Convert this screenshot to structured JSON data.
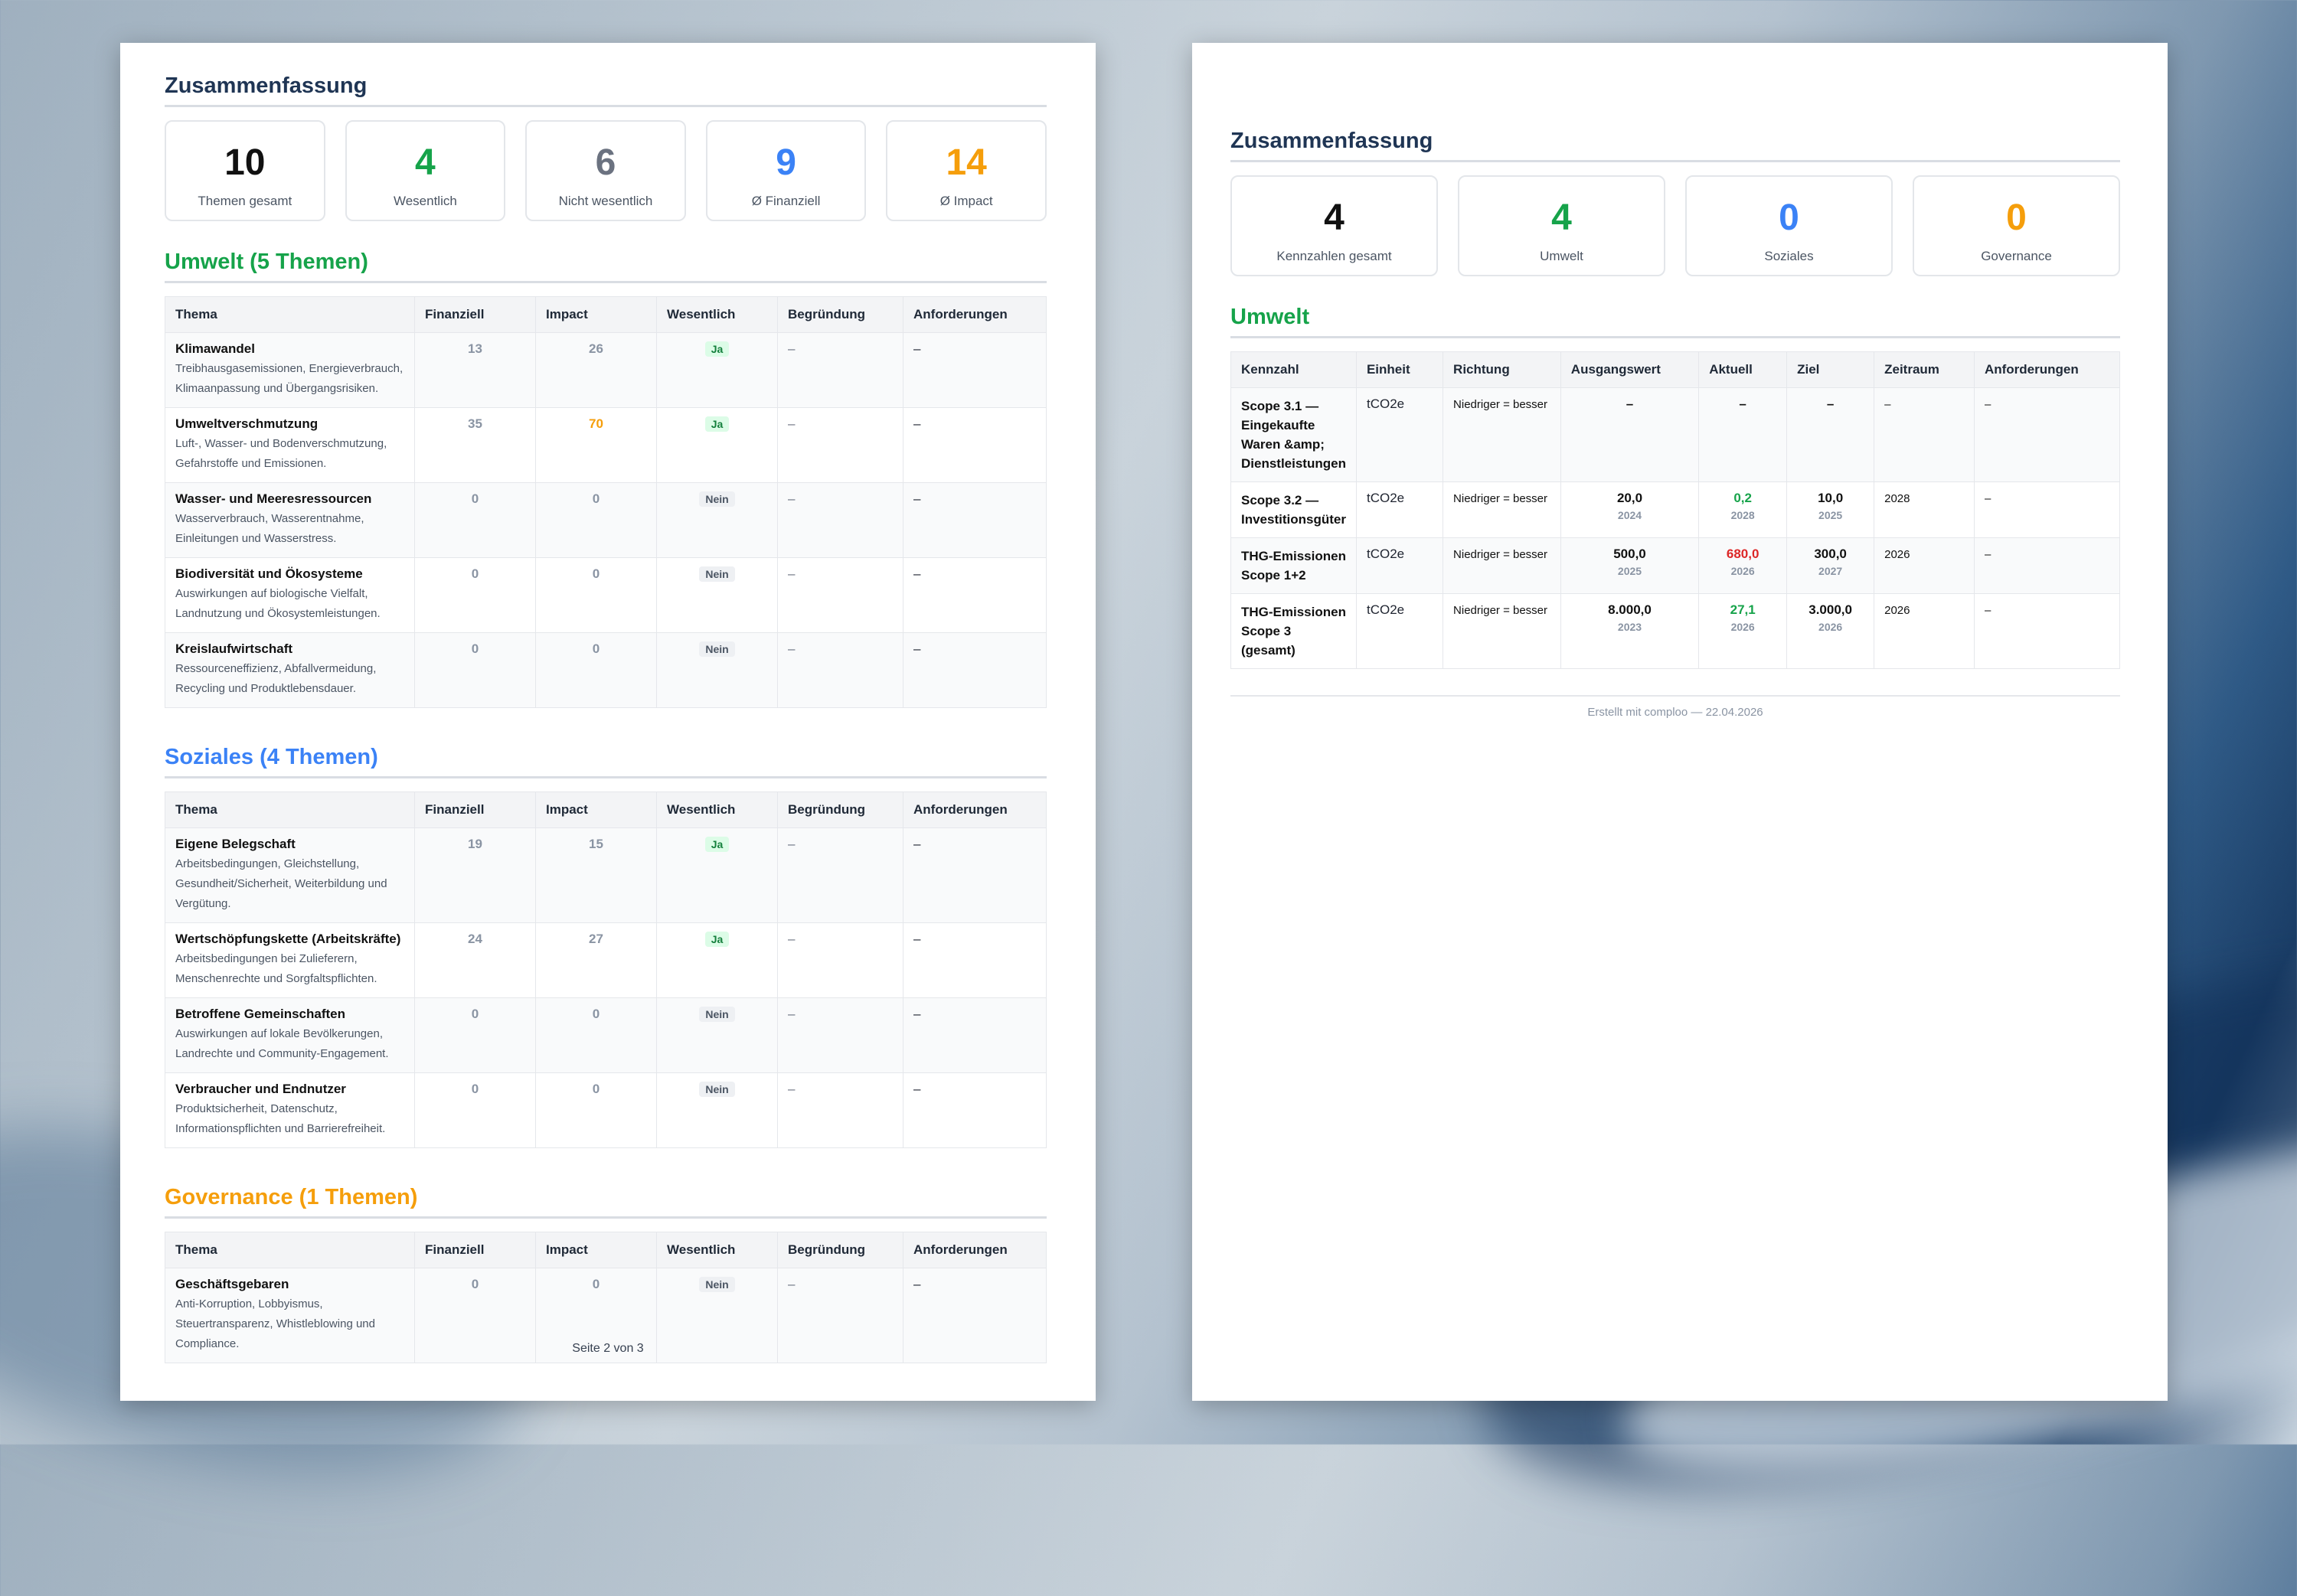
{
  "page1": {
    "summary_title": "Zusammenfassung",
    "cards": [
      {
        "value": "10",
        "label": "Themen gesamt",
        "color": "#111111"
      },
      {
        "value": "4",
        "label": "Wesentlich",
        "color": "#16a34a"
      },
      {
        "value": "6",
        "label": "Nicht wesentlich",
        "color": "#6b7280"
      },
      {
        "value": "9",
        "label": "Ø Finanziell",
        "color": "#3b82f6"
      },
      {
        "value": "14",
        "label": "Ø Impact",
        "color": "#f59e0b"
      }
    ],
    "columns": [
      "Thema",
      "Finanziell",
      "Impact",
      "Wesentlich",
      "Begründung",
      "Anforderungen"
    ],
    "sections": [
      {
        "title": "Umwelt (5 Themen)",
        "rows": [
          {
            "name": "Klimawandel",
            "desc": "Treibhausgasemissionen, Energieverbrauch, Klimaanpassung und Übergangsrisiken.",
            "fin": "13",
            "imp": "26",
            "wes": "Ja",
            "begr": "–",
            "anf": "–"
          },
          {
            "name": "Umweltverschmutzung",
            "desc": "Luft-, Wasser- und Bodenverschmutzung, Gefahrstoffe und Emissionen.",
            "fin": "35",
            "imp": "70",
            "wes": "Ja",
            "begr": "–",
            "anf": "–"
          },
          {
            "name": "Wasser- und Meeresressourcen",
            "desc": "Wasserverbrauch, Wasserentnahme, Einleitungen und Wasserstress.",
            "fin": "0",
            "imp": "0",
            "wes": "Nein",
            "begr": "–",
            "anf": "–"
          },
          {
            "name": "Biodiversität und Ökosysteme",
            "desc": "Auswirkungen auf biologische Vielfalt, Landnutzung und Ökosystemleistungen.",
            "fin": "0",
            "imp": "0",
            "wes": "Nein",
            "begr": "–",
            "anf": "–"
          },
          {
            "name": "Kreislaufwirtschaft",
            "desc": "Ressourceneffizienz, Abfallvermeidung, Recycling und Produktlebensdauer.",
            "fin": "0",
            "imp": "0",
            "wes": "Nein",
            "begr": "–",
            "anf": "–"
          }
        ]
      },
      {
        "title": "Soziales (4 Themen)",
        "rows": [
          {
            "name": "Eigene Belegschaft",
            "desc": "Arbeitsbedingungen, Gleichstellung, Gesundheit/Sicherheit, Weiterbildung und Vergütung.",
            "fin": "19",
            "imp": "15",
            "wes": "Ja",
            "begr": "–",
            "anf": "–"
          },
          {
            "name": "Wertschöpfungskette (Arbeitskräfte)",
            "desc": "Arbeitsbedingungen bei Zulieferern, Menschenrechte und Sorgfaltspflichten.",
            "fin": "24",
            "imp": "27",
            "wes": "Ja",
            "begr": "–",
            "anf": "–"
          },
          {
            "name": "Betroffene Gemeinschaften",
            "desc": "Auswirkungen auf lokale Bevölkerungen, Landrechte und Community-Engagement.",
            "fin": "0",
            "imp": "0",
            "wes": "Nein",
            "begr": "–",
            "anf": "–"
          },
          {
            "name": "Verbraucher und Endnutzer",
            "desc": "Produktsicherheit, Datenschutz, Informationspflichten und Barrierefreiheit.",
            "fin": "0",
            "imp": "0",
            "wes": "Nein",
            "begr": "–",
            "anf": "–"
          }
        ]
      },
      {
        "title": "Governance (1 Themen)",
        "rows": [
          {
            "name": "Geschäftsgebaren",
            "desc": "Anti-Korruption, Lobbyismus, Steuertransparenz, Whistleblowing und Compliance.",
            "fin": "0",
            "imp": "0",
            "wes": "Nein",
            "begr": "–",
            "anf": "–"
          }
        ]
      }
    ],
    "footer": "Seite 2 von 3"
  },
  "page2": {
    "summary_title": "Zusammenfassung",
    "cards": [
      {
        "value": "4",
        "label": "Kennzahlen gesamt",
        "color": "#111111"
      },
      {
        "value": "4",
        "label": "Umwelt",
        "color": "#16a34a"
      },
      {
        "value": "0",
        "label": "Soziales",
        "color": "#3b82f6"
      },
      {
        "value": "0",
        "label": "Governance",
        "color": "#f59e0b"
      }
    ],
    "section_title": "Umwelt",
    "columns": [
      "Kennzahl",
      "Einheit",
      "Richtung",
      "Ausgangswert",
      "Aktuell",
      "Ziel",
      "Zeitraum",
      "Anforderungen"
    ],
    "rows": [
      {
        "name": "Scope 3.1 — Eingekaufte Waren &amp; Dienstleistungen",
        "unit": "tCO2e",
        "dir": "Niedriger = besser",
        "base": "–",
        "base_year": "",
        "cur": "–",
        "cur_year": "",
        "cur_state": "none",
        "target": "–",
        "target_year": "",
        "period": "–",
        "req": "–"
      },
      {
        "name": "Scope 3.2 — Investitionsgüter",
        "unit": "tCO2e",
        "dir": "Niedriger = besser",
        "base": "20,0",
        "base_year": "2024",
        "cur": "0,2",
        "cur_year": "2028",
        "cur_state": "good",
        "target": "10,0",
        "target_year": "2025",
        "period": "2028",
        "req": "–"
      },
      {
        "name": "THG-Emissionen Scope 1+2",
        "unit": "tCO2e",
        "dir": "Niedriger = besser",
        "base": "500,0",
        "base_year": "2025",
        "cur": "680,0",
        "cur_year": "2026",
        "cur_state": "bad",
        "target": "300,0",
        "target_year": "2027",
        "period": "2026",
        "req": "–"
      },
      {
        "name": "THG-Emissionen Scope 3 (gesamt)",
        "unit": "tCO2e",
        "dir": "Niedriger = besser",
        "base": "8.000,0",
        "base_year": "2023",
        "cur": "27,1",
        "cur_year": "2026",
        "cur_state": "good",
        "target": "3.000,0",
        "target_year": "2026",
        "period": "2026",
        "req": "–"
      }
    ],
    "footer": "Erstellt mit comploo — 22.04.2026"
  }
}
